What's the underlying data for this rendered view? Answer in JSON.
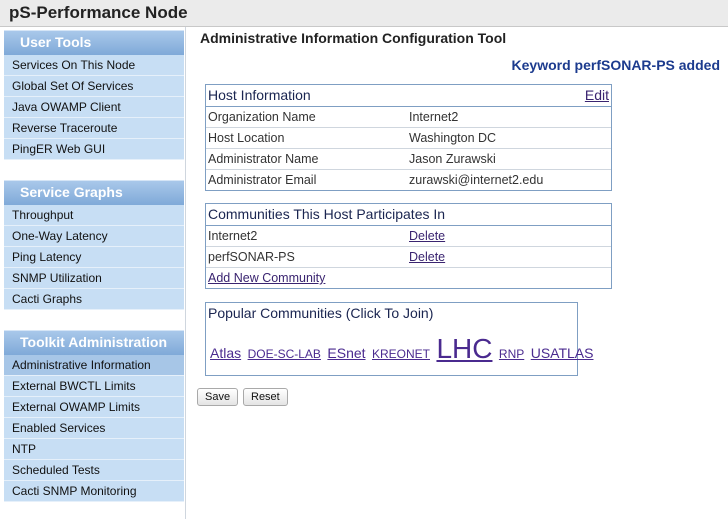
{
  "app": {
    "title": "pS-Performance Node"
  },
  "sidebar": {
    "sections": [
      {
        "title": "User Tools",
        "items": [
          "Services On This Node",
          "Global Set Of Services",
          "Java OWAMP Client",
          "Reverse Traceroute",
          "PingER Web GUI"
        ]
      },
      {
        "title": "Service Graphs",
        "items": [
          "Throughput",
          "One-Way Latency",
          "Ping Latency",
          "SNMP Utilization",
          "Cacti Graphs"
        ]
      },
      {
        "title": "Toolkit Administration",
        "items": [
          "Administrative Information",
          "External BWCTL Limits",
          "External OWAMP Limits",
          "Enabled Services",
          "NTP",
          "Scheduled Tests",
          "Cacti SNMP Monitoring"
        ]
      }
    ],
    "active_item": "Administrative Information"
  },
  "main": {
    "title": "Administrative Information Configuration Tool",
    "status_message": "Keyword perfSONAR-PS added",
    "host_info": {
      "heading": "Host Information",
      "edit_label": "Edit",
      "rows": [
        {
          "label": "Organization Name",
          "value": "Internet2"
        },
        {
          "label": "Host Location",
          "value": "Washington DC"
        },
        {
          "label": "Administrator Name",
          "value": "Jason Zurawski"
        },
        {
          "label": "Administrator Email",
          "value": "zurawski@internet2.edu"
        }
      ]
    },
    "communities": {
      "heading": "Communities This Host Participates In",
      "rows": [
        {
          "name": "Internet2",
          "action": "Delete"
        },
        {
          "name": "perfSONAR-PS",
          "action": "Delete"
        }
      ],
      "add_label": "Add New Community"
    },
    "popular": {
      "heading": "Popular Communities (Click To Join)",
      "tags": [
        {
          "label": "Atlas",
          "size": 14
        },
        {
          "label": "DOE-SC-LAB",
          "size": 12
        },
        {
          "label": "ESnet",
          "size": 14
        },
        {
          "label": "KREONET",
          "size": 12
        },
        {
          "label": "LHC",
          "size": 28
        },
        {
          "label": "RNP",
          "size": 12
        },
        {
          "label": "USATLAS",
          "size": 14
        }
      ]
    },
    "buttons": {
      "save": "Save",
      "reset": "Reset"
    }
  }
}
